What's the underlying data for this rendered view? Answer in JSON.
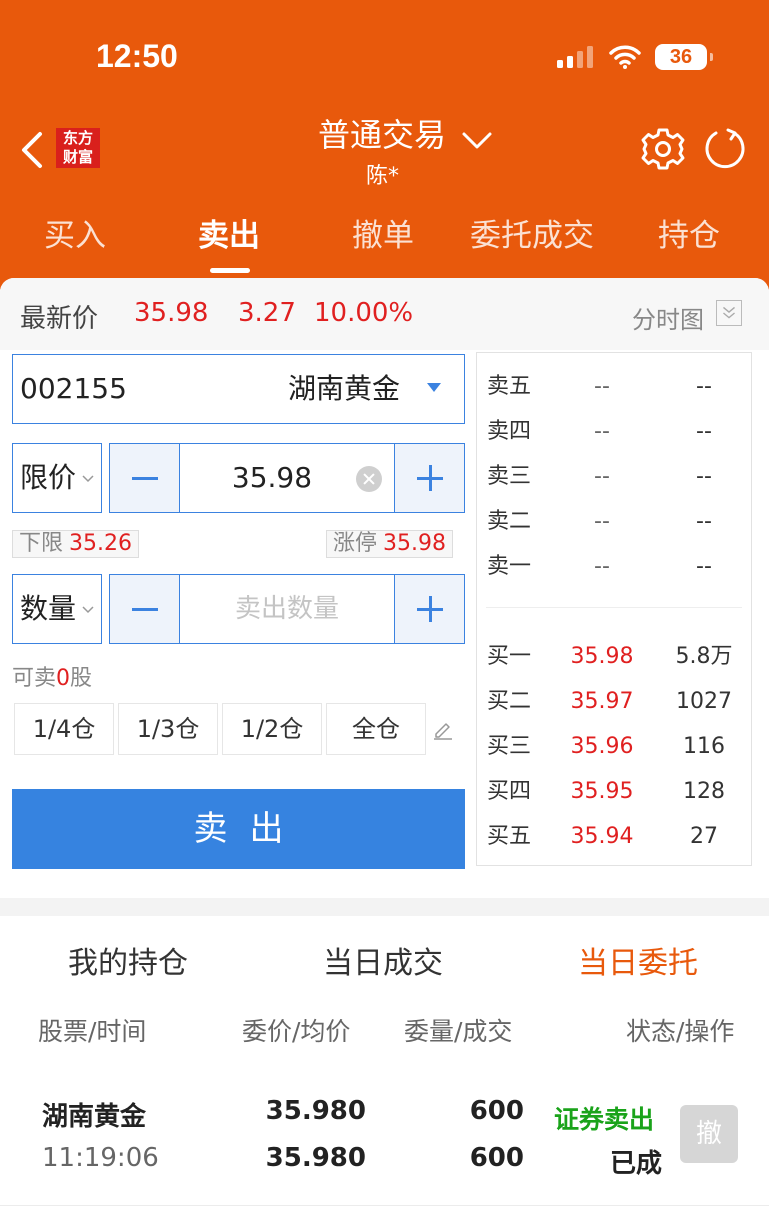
{
  "status_bar": {
    "time": "12:50",
    "battery": "36"
  },
  "nav": {
    "logo": "东方财富",
    "title": "普通交易",
    "subtitle": "陈*"
  },
  "tabs": [
    "买入",
    "卖出",
    "撤单",
    "委托成交",
    "持仓"
  ],
  "quote": {
    "label": "最新价",
    "price": "35.98",
    "change": "3.27",
    "percent": "10.00%",
    "chart_label": "分时图"
  },
  "form": {
    "stock_code": "002155",
    "stock_name": "湖南黄金",
    "price_type": "限价",
    "price": "35.98",
    "lower_limit_label": "下限",
    "lower_limit": "35.26",
    "upper_limit_label": "涨停",
    "upper_limit": "35.98",
    "qty_type": "数量",
    "qty_placeholder": "卖出数量",
    "available_prefix": "可卖",
    "available_qty": "0",
    "available_unit": "股",
    "ratios": [
      "1/4仓",
      "1/3仓",
      "1/2仓",
      "全仓"
    ],
    "sell_button": "卖出"
  },
  "order_book": {
    "asks": [
      {
        "label": "卖五",
        "price": "--",
        "volume": "--"
      },
      {
        "label": "卖四",
        "price": "--",
        "volume": "--"
      },
      {
        "label": "卖三",
        "price": "--",
        "volume": "--"
      },
      {
        "label": "卖二",
        "price": "--",
        "volume": "--"
      },
      {
        "label": "卖一",
        "price": "--",
        "volume": "--"
      }
    ],
    "bids": [
      {
        "label": "买一",
        "price": "35.98",
        "volume": "5.8万"
      },
      {
        "label": "买二",
        "price": "35.97",
        "volume": "1027"
      },
      {
        "label": "买三",
        "price": "35.96",
        "volume": "116"
      },
      {
        "label": "买四",
        "price": "35.95",
        "volume": "128"
      },
      {
        "label": "买五",
        "price": "35.94",
        "volume": "27"
      }
    ]
  },
  "bottom_tabs": [
    "我的持仓",
    "当日成交",
    "当日委托"
  ],
  "columns": [
    "股票/时间",
    "委价/均价",
    "委量/成交",
    "状态/操作"
  ],
  "orders": [
    {
      "name": "湖南黄金",
      "time": "11:19:06",
      "order_price": "35.980",
      "avg_price": "35.980",
      "order_qty": "600",
      "filled_qty": "600",
      "type": "证券卖出",
      "status": "已成",
      "action": "撤"
    }
  ],
  "colors": {
    "brand": "#E8590C",
    "accent_blue": "#3683e0",
    "up_red": "#e02020",
    "sell_green": "#1aa31a"
  }
}
